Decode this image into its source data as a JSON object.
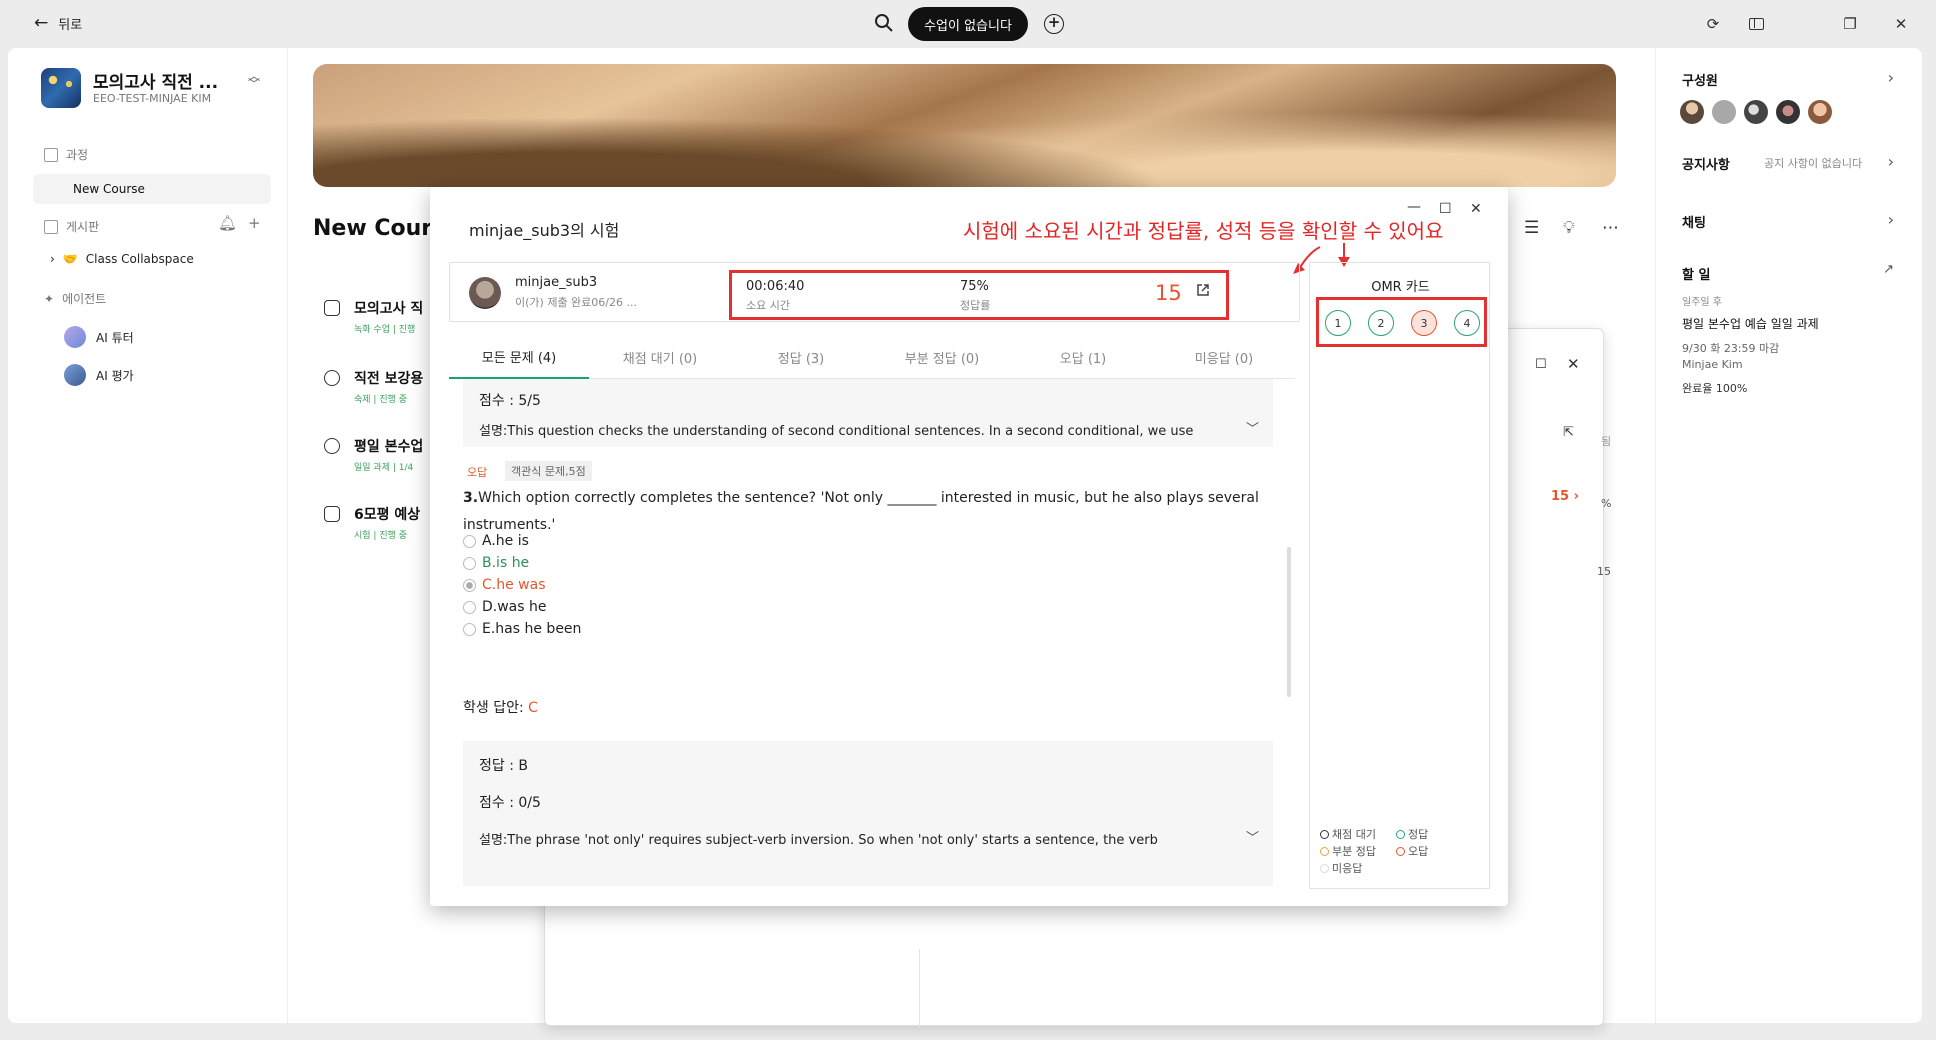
{
  "topbar": {
    "back_label": "뒤로",
    "pill_label": "수업이 없습니다"
  },
  "workspace": {
    "name": "모의고사 직전 ...",
    "sub": "EEO-TEST-MINJAE KIM"
  },
  "sidebar": {
    "section_course": "과정",
    "selected_course": "New Course",
    "section_board": "게시판",
    "channel": "Class Collabspace",
    "section_agent": "에이전트",
    "agents": [
      "AI 튜터",
      "AI 평가"
    ]
  },
  "main": {
    "course_title": "New Cours",
    "assignments": [
      {
        "title": "모의고사 직",
        "sub": "녹화 수업 | 진행"
      },
      {
        "title": "직전 보강용",
        "sub": "숙제 | 진행 중"
      },
      {
        "title": "평일 본수업",
        "sub": "일일 과제 | 1/4"
      },
      {
        "title": "6모평 예상",
        "sub": "시험 | 진행 중"
      }
    ]
  },
  "under_dialog": {
    "score": "15",
    "pct_fragment": "%",
    "row_value": "15",
    "side_fragment": "됨"
  },
  "right_panel": {
    "members": "구성원",
    "notice": "공지사항",
    "notice_empty": "공지 사항이 없습니다",
    "chat": "채팅",
    "todo": "할 일",
    "todo_when": "일주일 후",
    "todo_title": "평일 본수업 예습 일일 과제",
    "todo_due": "9/30 화 23:59 마감",
    "todo_owner": "Minjae Kim",
    "todo_rate": "완료율 100%"
  },
  "modal": {
    "title": "minjae_sub3의 시험",
    "annotation": "시험에 소요된 시간과 정답률, 성적 등을 확인할 수 있어요",
    "student_name": "minjae_sub3",
    "student_sub": "이(가) 제출 완료06/26 ...",
    "time_value": "00:06:40",
    "time_label": "소요 시간",
    "rate_value": "75%",
    "rate_label": "정답률",
    "score": "15",
    "tabs": [
      "모든 문제 (4)",
      "채점 대기 (0)",
      "정답 (3)",
      "부분 정답 (0)",
      "오답 (1)",
      "미응답 (0)"
    ],
    "prev_score": "점수 : 5/5",
    "prev_expl": "설명:This question checks the understanding of second conditional sentences. In a second conditional, we use",
    "tag_wrong": "오답",
    "tag_type": "객관식 문제,5점",
    "question_num": "3.",
    "question": "Which option correctly completes the sentence? 'Not only _______ interested in music, but he also plays several instruments.'",
    "options": [
      "A.he is",
      "B.is he",
      "C.he was",
      "D.was he",
      "E.has he been"
    ],
    "student_answer_label": "학생 답안:",
    "student_answer": "C",
    "correct": "정답 : B",
    "score_line": "점수 : 0/5",
    "expl": "설명:The phrase 'not only' requires subject-verb inversion. So when 'not only' starts a sentence, the verb"
  },
  "omr": {
    "title": "OMR 카드",
    "bubbles": [
      "1",
      "2",
      "3",
      "4"
    ],
    "legend": [
      "채점 대기",
      "정답",
      "부분 정답",
      "오답",
      "미응답"
    ]
  },
  "colors": {
    "accent": "#19a46a",
    "wrong": "#e4572e",
    "annotation": "#e53030"
  }
}
